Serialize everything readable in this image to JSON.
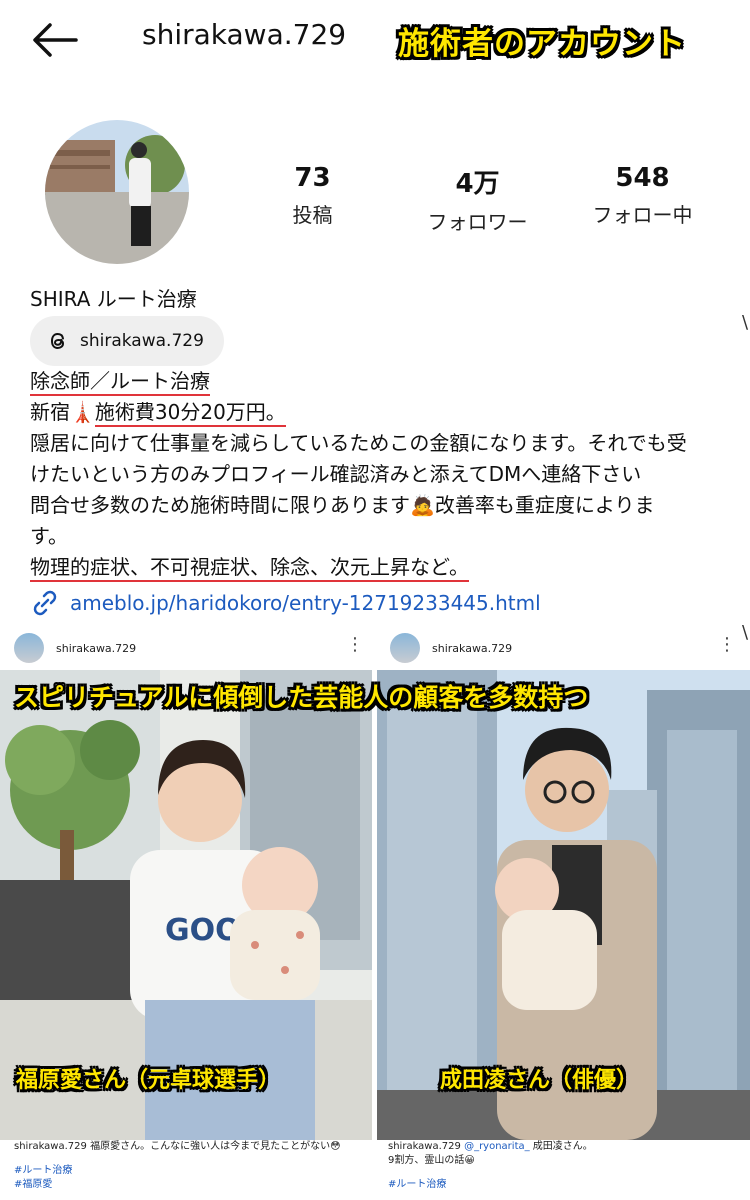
{
  "header": {
    "username": "shirakawa.729",
    "banner_title": "施術者のアカウント"
  },
  "stats": {
    "posts": {
      "value": "73",
      "label": "投稿"
    },
    "followers": {
      "value": "4万",
      "label": "フォロワー"
    },
    "following": {
      "value": "548",
      "label": "フォロー中"
    }
  },
  "profile": {
    "display_name": "SHIRA ルート治療",
    "threads_handle": "shirakawa.729",
    "bio": {
      "line1": "除念師／ルート治療",
      "line2_prefix": "新宿",
      "line2_tower": "🗼",
      "line2_fee": "施術費30分20万円。",
      "line3": "隠居に向けて仕事量を減らしているためこの金額になります。それでも受",
      "line4": "けたいという方のみプロフィール確認済みと添えてDMへ連絡下さい",
      "line5": "問合せ多数のため施術時間に限りあります🙇改善率も重症度によりま",
      "line6": "す。",
      "line7": "物理的症状、不可視症状、除念、次元上昇など。"
    },
    "link": "ameblo.jp/haridokoro/entry-12719233445.html"
  },
  "edge_marks": {
    "upper": "\\",
    "lower": "\\"
  },
  "posts": {
    "left": {
      "username": "shirakawa.729",
      "overlay_caption": "福原愛さん（元卓球選手）",
      "caption_user": "shirakawa.729",
      "caption_text": " 福原愛さん。こんなに強い人は今まで見たことがない😳",
      "tag1": "#ルート治療",
      "tag2": "#福原愛"
    },
    "right": {
      "username": "shirakawa.729",
      "overlay_caption": "成田凌さん（俳優）",
      "caption_user": "shirakawa.729",
      "caption_mention": " @_ryonarita_",
      "caption_text": " 成田凌さん。",
      "caption_line2": "9割方、霊山の話😀",
      "tag1": "#ルート治療"
    },
    "overlay_top": "スピリチュアルに傾倒した芸能人の顧客を多数持つ"
  },
  "colors": {
    "highlight_yellow": "#ffe600",
    "underline_red": "#e0343a",
    "link_blue": "#1d5bbf"
  }
}
